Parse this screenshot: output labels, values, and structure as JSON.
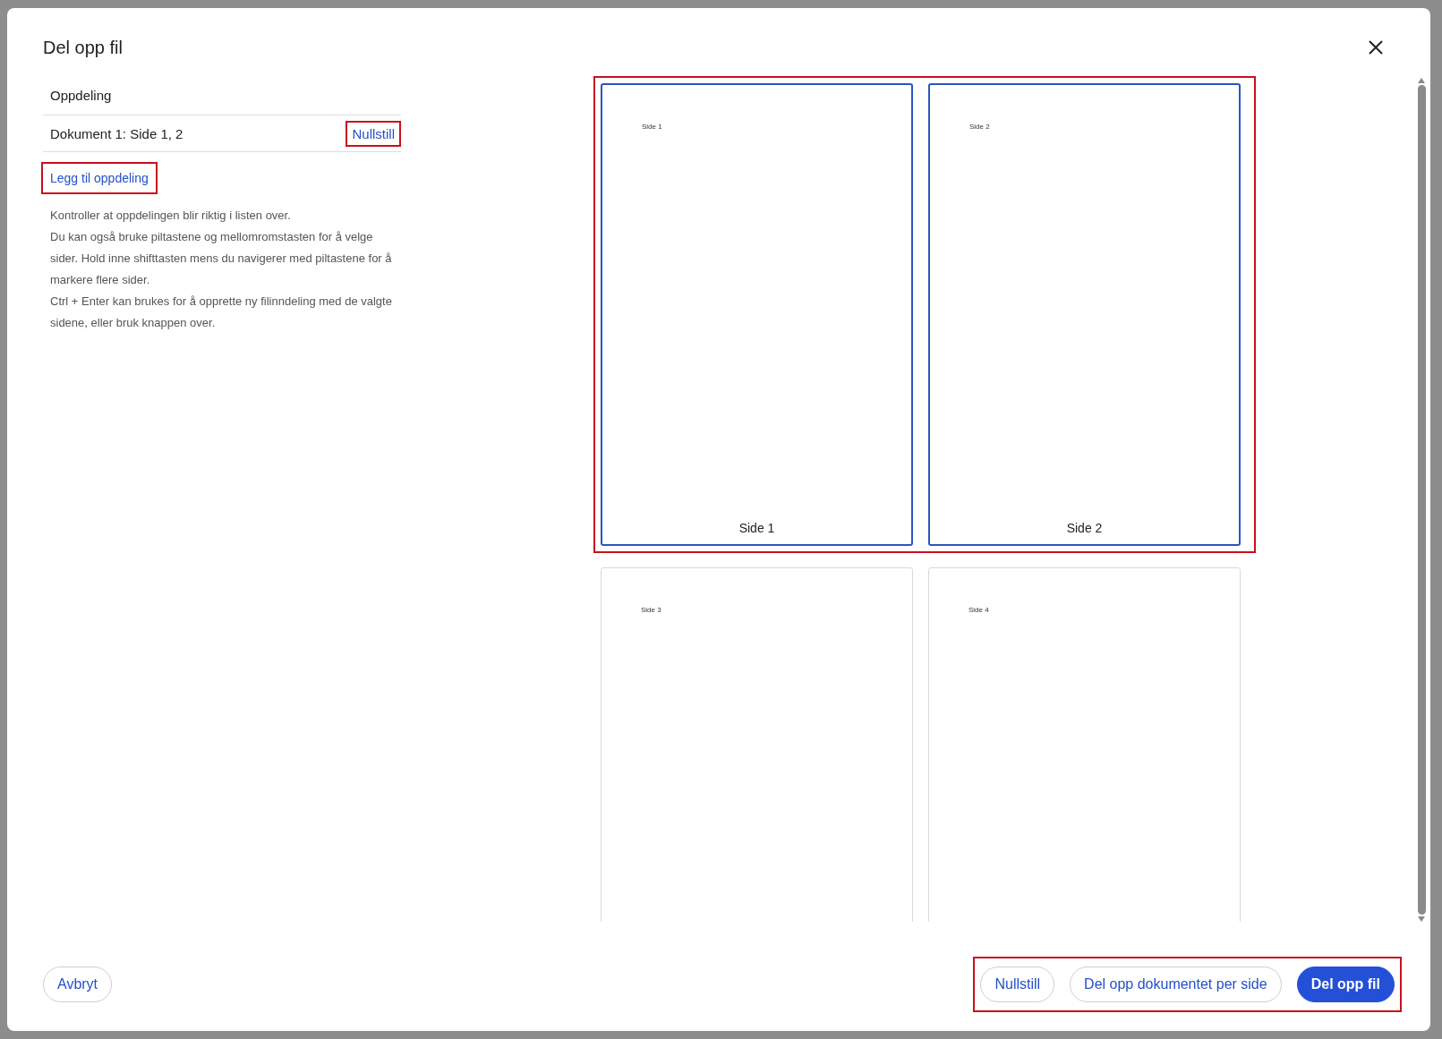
{
  "dialog": {
    "title": "Del opp fil"
  },
  "splitting": {
    "heading": "Oppdeling",
    "documents": [
      {
        "label": "Dokument 1: Side 1, 2",
        "reset": "Nullstill",
        "highlighted": true
      }
    ],
    "add_button": {
      "label": "Legg til oppdeling",
      "highlighted": true
    },
    "help": [
      "Kontroller at oppdelingen blir riktig i listen over.",
      "Du kan også bruke piltastene og mellomromstasten for å velge sider. Hold inne shifttasten mens du navigerer med piltastene for å markere flere sider.",
      "Ctrl + Enter kan brukes for å opprette ny filinndeling med de valgte sidene, eller bruk knappen over."
    ]
  },
  "page_groups": [
    {
      "highlighted": true,
      "pages": [
        {
          "label": "Side 1",
          "caption": "Side 1",
          "selected": true
        },
        {
          "label": "Side 2",
          "caption": "Side 2",
          "selected": true
        }
      ]
    },
    {
      "highlighted": false,
      "pages": [
        {
          "label": "Side 3",
          "selected": false
        },
        {
          "label": "Side 4",
          "selected": false
        }
      ]
    }
  ],
  "footer": {
    "cancel": "Avbryt",
    "actions_highlighted": true,
    "actions": [
      {
        "label": "Nullstill",
        "kind": "secondary"
      },
      {
        "label": "Del opp dokumentet per side",
        "kind": "secondary"
      },
      {
        "label": "Del opp fil",
        "kind": "primary"
      }
    ]
  }
}
